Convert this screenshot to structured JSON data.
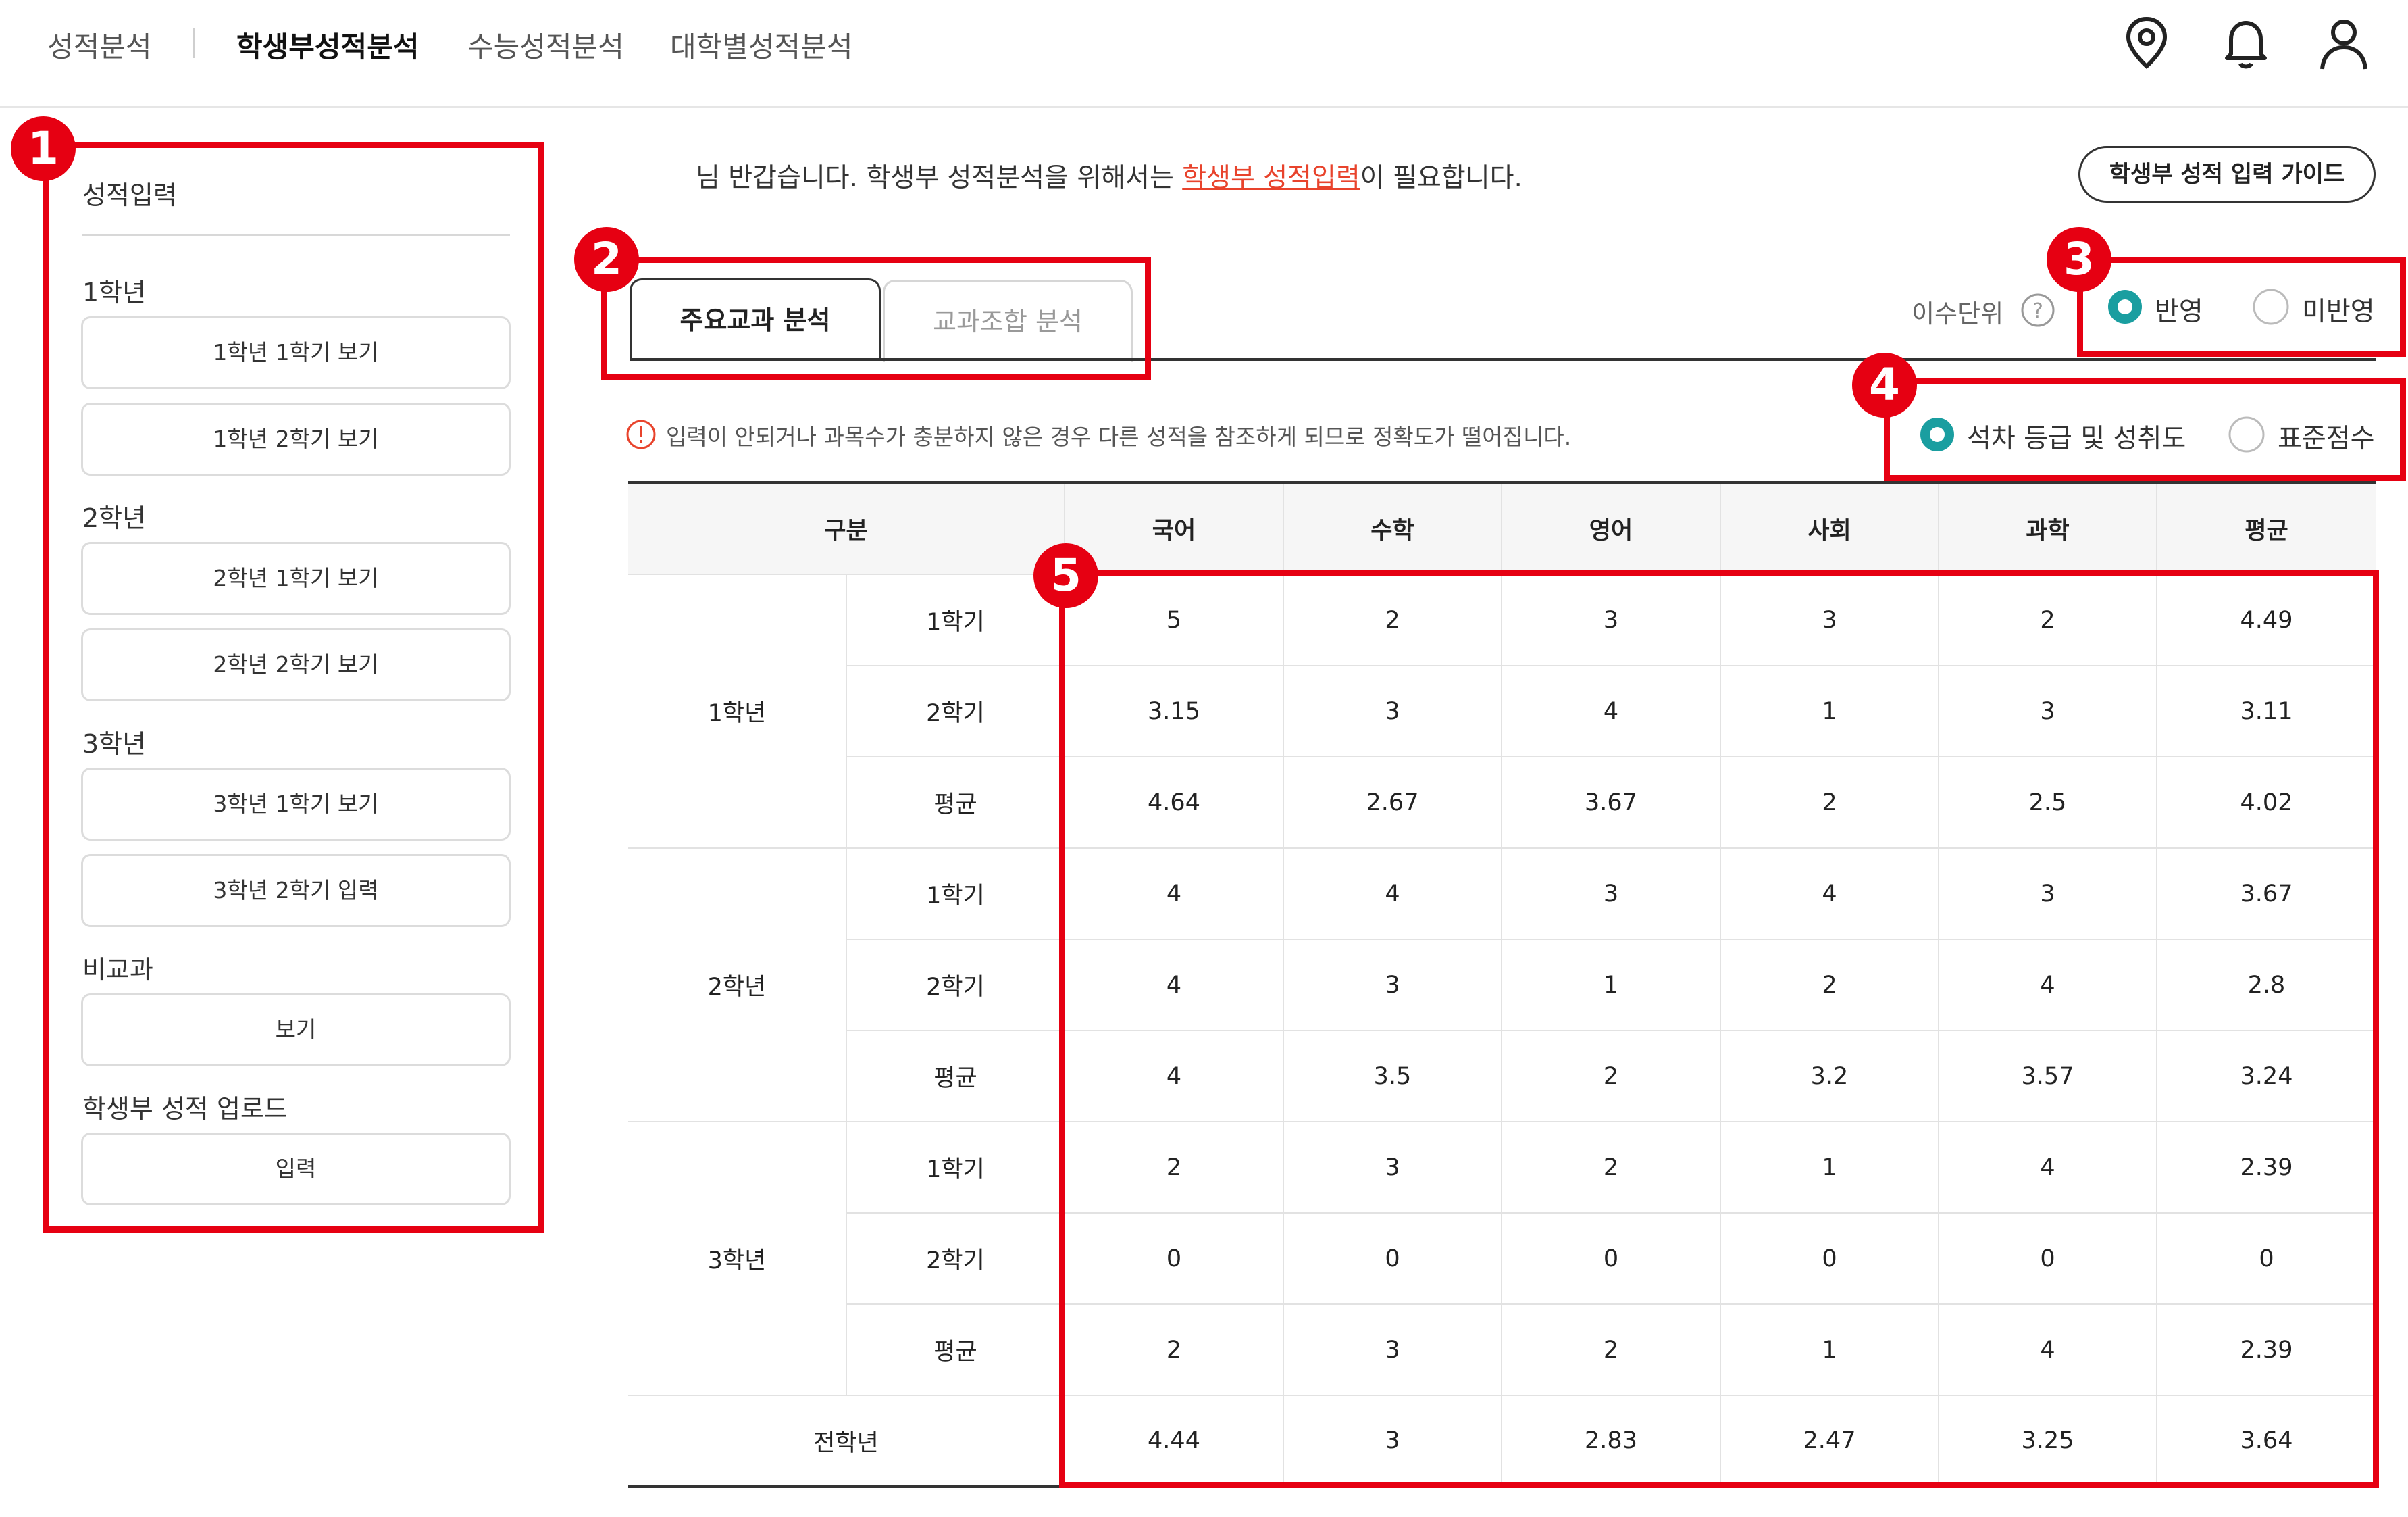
{
  "nav": {
    "items": [
      {
        "label": "성적분석",
        "active": false
      },
      {
        "label": "학생부성적분석",
        "active": true
      },
      {
        "label": "수능성적분석",
        "active": false
      },
      {
        "label": "대학별성적분석",
        "active": false
      }
    ],
    "icons": [
      "location-icon",
      "bell-icon",
      "user-icon"
    ]
  },
  "sidebar": {
    "title": "성적입력",
    "groups": [
      {
        "heading": "1학년",
        "buttons": [
          "1학년 1학기 보기",
          "1학년 2학기 보기"
        ]
      },
      {
        "heading": "2학년",
        "buttons": [
          "2학년 1학기 보기",
          "2학년 2학기 보기"
        ]
      },
      {
        "heading": "3학년",
        "buttons": [
          "3학년 1학기 보기",
          "3학년 2학기 입력"
        ]
      },
      {
        "heading": "비교과",
        "buttons": [
          "보기"
        ]
      },
      {
        "heading": "학생부 성적 업로드",
        "buttons": [
          "입력"
        ]
      }
    ]
  },
  "greeting": {
    "prefix": "님 반갑습니다. 학생부 성적분석을 위해서는 ",
    "link": "학생부 성적입력",
    "suffix": "이 필요합니다."
  },
  "guide_button": "학생부 성적 입력 가이드",
  "tabs": [
    "주요교과 분석",
    "교과조합 분석"
  ],
  "isu": {
    "label": "이수단위",
    "options": [
      {
        "label": "반영",
        "selected": true
      },
      {
        "label": "미반영",
        "selected": false
      }
    ]
  },
  "score_type": {
    "options": [
      {
        "label": "석차 등급 및 성취도",
        "selected": true
      },
      {
        "label": "표준점수",
        "selected": false
      }
    ]
  },
  "notice": "입력이 안되거나 과목수가 충분하지 않은 경우 다른 성적을 참조하게 되므로 정확도가 떨어집니다.",
  "table": {
    "header": [
      "구분",
      "국어",
      "수학",
      "영어",
      "사회",
      "과학",
      "평균"
    ],
    "years": [
      {
        "year": "1학년",
        "rows": [
          {
            "term": "1학기",
            "values": [
              "5",
              "2",
              "3",
              "3",
              "2",
              "4.49"
            ]
          },
          {
            "term": "2학기",
            "values": [
              "3.15",
              "3",
              "4",
              "1",
              "3",
              "3.11"
            ]
          },
          {
            "term": "평균",
            "values": [
              "4.64",
              "2.67",
              "3.67",
              "2",
              "2.5",
              "4.02"
            ]
          }
        ]
      },
      {
        "year": "2학년",
        "rows": [
          {
            "term": "1학기",
            "values": [
              "4",
              "4",
              "3",
              "4",
              "3",
              "3.67"
            ]
          },
          {
            "term": "2학기",
            "values": [
              "4",
              "3",
              "1",
              "2",
              "4",
              "2.8"
            ]
          },
          {
            "term": "평균",
            "values": [
              "4",
              "3.5",
              "2",
              "3.2",
              "3.57",
              "3.24"
            ]
          }
        ]
      },
      {
        "year": "3학년",
        "rows": [
          {
            "term": "1학기",
            "values": [
              "2",
              "3",
              "2",
              "1",
              "4",
              "2.39"
            ]
          },
          {
            "term": "2학기",
            "values": [
              "0",
              "0",
              "0",
              "0",
              "0",
              "0"
            ]
          },
          {
            "term": "평균",
            "values": [
              "2",
              "3",
              "2",
              "1",
              "4",
              "2.39"
            ]
          }
        ]
      }
    ],
    "total": {
      "label": "전학년",
      "values": [
        "4.44",
        "3",
        "2.83",
        "2.47",
        "3.25",
        "3.64"
      ]
    }
  },
  "annotations": [
    "1",
    "2",
    "3",
    "4",
    "5"
  ],
  "colors": {
    "annotation_red": "#e60012",
    "radio_teal": "#1a9ea0",
    "link_red": "#e8432c"
  }
}
